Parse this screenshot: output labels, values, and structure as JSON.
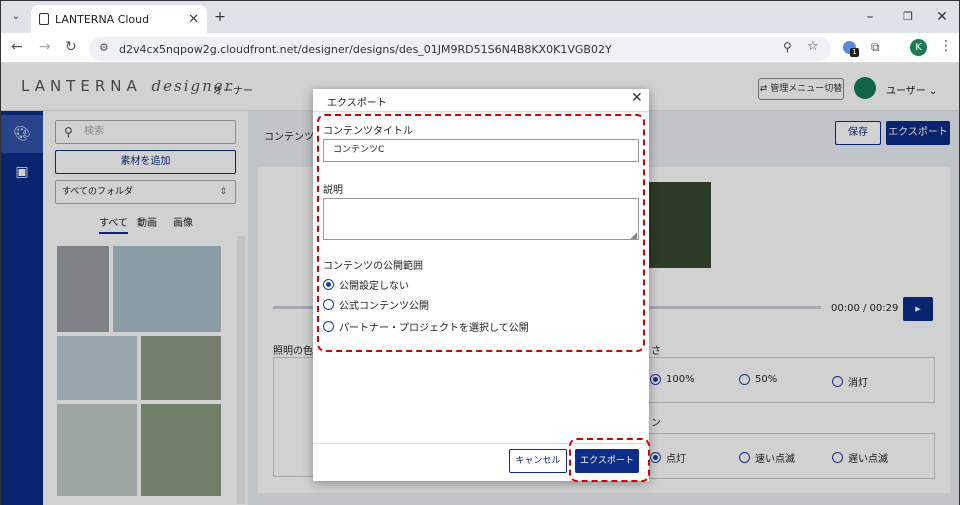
{
  "browser": {
    "tab_title": "LANTERNA Cloud",
    "url": "d2v4cx5nqpow2g.cloudfront.net/designer/designs/des_01JM9RD51S6N4B8KX0K1VGB02Y",
    "profile_initial": "K",
    "extension_badge": "1"
  },
  "app": {
    "logo_main": "LANTERNA",
    "logo_sub": "designer",
    "role": "オーナー",
    "switch_menu": "管理メニュー切替",
    "user_name": "ユーザー",
    "brand_color": "#0b2d87"
  },
  "panel": {
    "search_placeholder": "検索",
    "add_material": "素材を追加",
    "folder_select": "すべてのフォルダ",
    "tabs": [
      "すべて",
      "動画",
      "画像"
    ]
  },
  "main": {
    "breadcrumb": "コンテンツC",
    "save": "保存",
    "export": "エクスポート",
    "time": "00:00 / 00:29",
    "lighting_color_label": "照明の色",
    "brightness_label": "さ",
    "brightness_options": [
      "100%",
      "50%",
      "消灯"
    ],
    "pattern_label": "ン",
    "pattern_options": [
      "点灯",
      "速い点滅",
      "遅い点滅"
    ]
  },
  "modal": {
    "title": "エクスポート",
    "content_title_label": "コンテンツタイトル",
    "content_title_value": "コンテンツC",
    "description_label": "説明",
    "scope_label": "コンテンツの公開範囲",
    "scope_options": [
      "公開設定しない",
      "公式コンテンツ公開",
      "パートナー・プロジェクトを選択して公開"
    ],
    "cancel": "キャンセル",
    "export": "エクスポート"
  }
}
